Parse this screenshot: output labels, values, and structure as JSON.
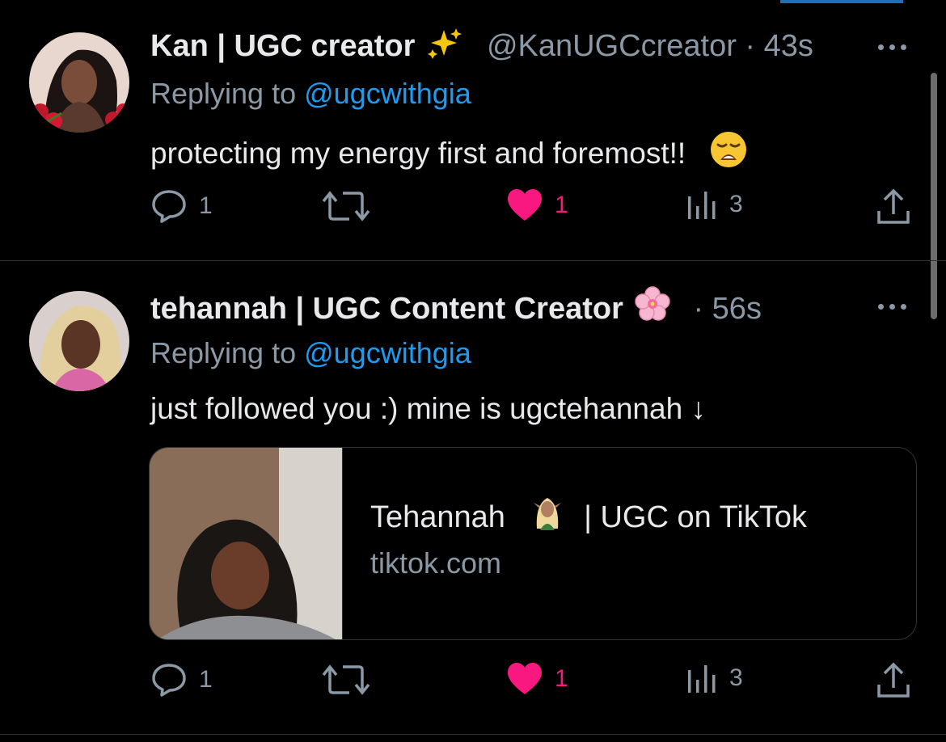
{
  "tweets": [
    {
      "name": "Kan | UGC creator",
      "name_emoji": "sparkles",
      "handle": "@KanUGCcreator",
      "separator": "·",
      "time": "43s",
      "replying_prefix": "Replying to",
      "replying_to": "@ugcwithgia",
      "text": "protecting my energy first and foremost!!",
      "text_emoji": "weary-face",
      "counts": {
        "reply": "1",
        "retweet": "",
        "like": "1",
        "views": "3"
      },
      "liked": true
    },
    {
      "name": "tehannah | UGC Content Creator",
      "name_emoji": "cherry-blossom",
      "separator": "·",
      "time": "56s",
      "replying_prefix": "Replying to",
      "replying_to": "@ugcwithgia",
      "text": "just followed you :) mine is ugctehannah ↓",
      "card": {
        "title_name": "Tehannah",
        "title_emoji": "elf",
        "title_rest": "| UGC on TikTok",
        "domain": "tiktok.com"
      },
      "counts": {
        "reply": "1",
        "retweet": "",
        "like": "1",
        "views": "3"
      },
      "liked": true
    }
  ],
  "colors": {
    "background": "#000000",
    "text": "#e7e9ea",
    "muted": "#8b98a5",
    "link": "#1d9bf0",
    "like": "#f91880",
    "divider": "#2f3336"
  }
}
